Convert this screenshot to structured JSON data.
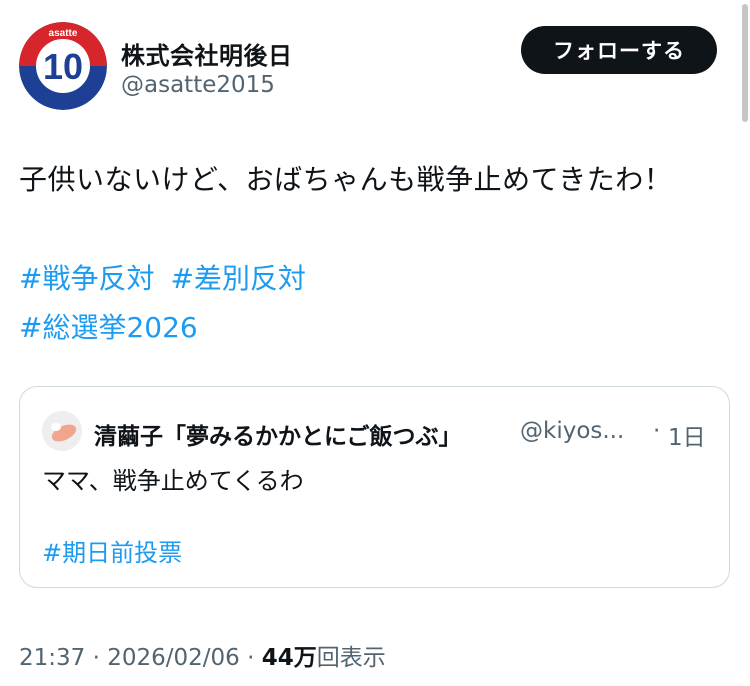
{
  "author": {
    "name": "株式会社明後日",
    "handle": "@asatte2015",
    "avatar_text": "asatte",
    "avatar_number": "10"
  },
  "follow_button": {
    "label": "フォローする"
  },
  "tweet": {
    "text": "子供いないけど、おばちゃんも戦争止めてきたわ！",
    "hashtags": [
      "#戦争反対",
      "#差別反対",
      "#総選挙2026"
    ]
  },
  "quote": {
    "name": "清繭子「夢みるかかとにご飯つぶ」",
    "handle": "@kiyos...",
    "separator": "·",
    "time": "1日",
    "text": "ママ、戦争止めてくるわ",
    "hashtag": "#期日前投票"
  },
  "meta": {
    "time": "21:37",
    "date": "2026/02/06",
    "separator": " · ",
    "views_count": "44万",
    "views_label": "回表示"
  },
  "colors": {
    "accent": "#1d9bf0",
    "text": "#0f1419",
    "secondary": "#536471",
    "border": "#cfd9de",
    "logo_red": "#d7252c",
    "logo_blue": "#1d3f94"
  }
}
